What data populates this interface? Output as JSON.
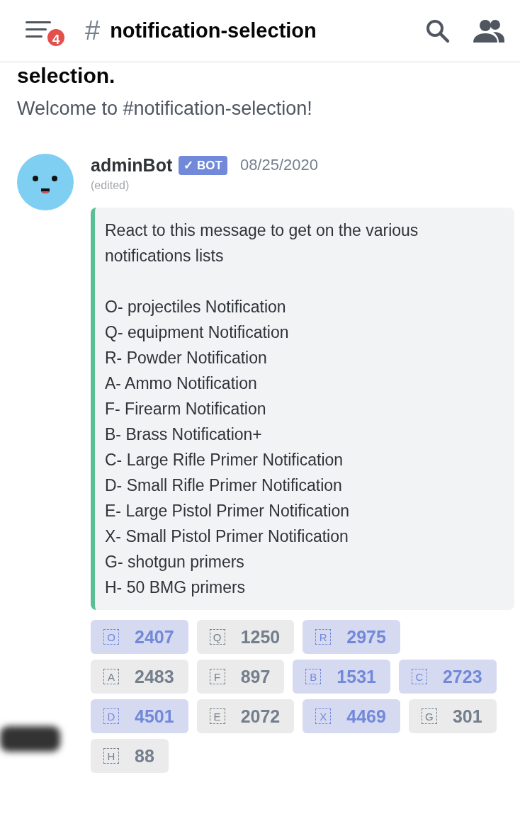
{
  "header": {
    "badge": "4",
    "hash": "#",
    "channel": "notification-selection"
  },
  "heading": "selection.",
  "welcome": "Welcome to #notification-selection!",
  "message": {
    "author": "adminBot",
    "bot_tag": {
      "check": "✓",
      "label": "BOT"
    },
    "date": "08/25/2020",
    "edited": "(edited)",
    "embed_intro": "React to this message to get on the various notifications lists",
    "embed_lines": [
      "O- projectiles Notification",
      "Q- equipment Notification",
      "R- Powder Notification",
      "A- Ammo Notification",
      "F- Firearm Notification",
      "B- Brass Notification+",
      "C- Large Rifle Primer Notification",
      "D- Small Rifle Primer Notification",
      "E- Large Pistol Primer Notification",
      "X- Small Pistol Primer Notification",
      "G- shotgun primers",
      "H- 50 BMG primers"
    ],
    "reaction_rows": [
      [
        {
          "emoji": "O",
          "count": "2407",
          "selected": true
        },
        {
          "emoji": "Q",
          "count": "1250",
          "selected": false
        },
        {
          "emoji": "R",
          "count": "2975",
          "selected": true
        }
      ],
      [
        {
          "emoji": "A",
          "count": "2483",
          "selected": false
        },
        {
          "emoji": "F",
          "count": "897",
          "selected": false
        },
        {
          "emoji": "B",
          "count": "1531",
          "selected": true
        },
        {
          "emoji": "C",
          "count": "2723",
          "selected": true
        }
      ],
      [
        {
          "emoji": "D",
          "count": "4501",
          "selected": true
        },
        {
          "emoji": "E",
          "count": "2072",
          "selected": false
        },
        {
          "emoji": "X",
          "count": "4469",
          "selected": true
        },
        {
          "emoji": "G",
          "count": "301",
          "selected": false
        }
      ],
      [
        {
          "emoji": "H",
          "count": "88",
          "selected": false
        }
      ]
    ]
  }
}
